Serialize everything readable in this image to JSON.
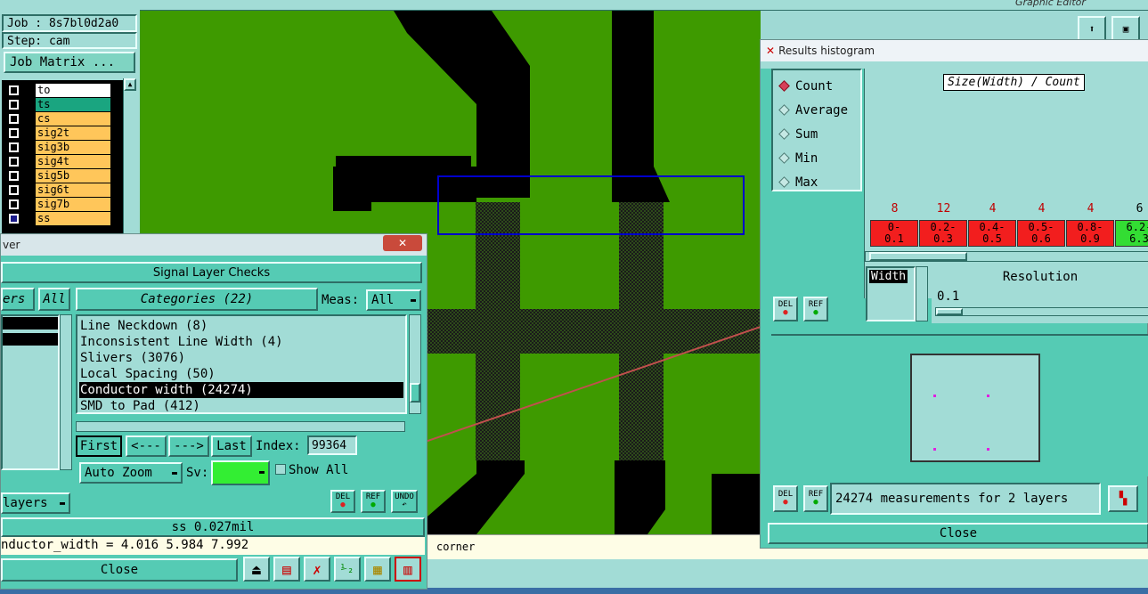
{
  "top_left": {
    "job": "Job : 8s7bl0d2a0",
    "step": "Step: cam",
    "job_matrix_button": "Job Matrix ..."
  },
  "layers": [
    {
      "name": "to",
      "color": "#ffffff"
    },
    {
      "name": "ts",
      "color": "#1aa580"
    },
    {
      "name": "cs",
      "color": "#ffc65a"
    },
    {
      "name": "sig2t",
      "color": "#ffc65a"
    },
    {
      "name": "sig3b",
      "color": "#ffc65a"
    },
    {
      "name": "sig4t",
      "color": "#ffc65a"
    },
    {
      "name": "sig5b",
      "color": "#ffc65a"
    },
    {
      "name": "sig6t",
      "color": "#ffc65a"
    },
    {
      "name": "sig7b",
      "color": "#ffc65a"
    },
    {
      "name": "ss",
      "color": "#ffc65a"
    }
  ],
  "graphic_editor_label": "Graphic Editor",
  "status_text": "corner",
  "checks_window": {
    "title_fragment": "ver",
    "close_x": "✕",
    "header": "Signal Layer Checks",
    "layers_fragment": "ers",
    "all_button": "All",
    "categories_label": "Categories (22)",
    "meas_label": "Meas:",
    "meas_value": "All",
    "categories": [
      "Line Neckdown (8)",
      "Inconsistent Line Width (4)",
      "Slivers (3076)",
      "Local Spacing (50)",
      "Conductor width (24274)",
      "SMD to Pad (412)"
    ],
    "selected_index": 4,
    "nav": {
      "first": "First",
      "prev": "<---",
      "next": "--->",
      "last": "Last"
    },
    "index_label": "Index:",
    "index_value": "99364",
    "auto_zoom": "Auto Zoom",
    "sv_label": "Sv:",
    "show_all": "Show All",
    "layers_dropdown": "layers",
    "del": "DEL",
    "ref": "REF",
    "undo": "UNDO",
    "measure_readout": "ss 0.027mil",
    "formula": "nductor_width = 4.016 5.984 7.992",
    "close": "Close"
  },
  "histogram_window": {
    "title": "Results histogram",
    "options": [
      "Count",
      "Average",
      "Sum",
      "Min",
      "Max"
    ],
    "selected_option": 0,
    "chart_title": "Size(Width) / Count",
    "bins": [
      {
        "count": "8",
        "label": [
          "0-",
          "0.1"
        ],
        "color": "#f21e1e"
      },
      {
        "count": "12",
        "label": [
          "0.2-",
          "0.3"
        ],
        "color": "#f21e1e"
      },
      {
        "count": "4",
        "label": [
          "0.4-",
          "0.5"
        ],
        "color": "#f21e1e"
      },
      {
        "count": "4",
        "label": [
          "0.5-",
          "0.6"
        ],
        "color": "#f21e1e"
      },
      {
        "count": "4",
        "label": [
          "0.8-",
          "0.9"
        ],
        "color": "#f21e1e"
      },
      {
        "count": "6",
        "label": [
          "6.2-",
          "6.3"
        ],
        "color": "#33dd33"
      }
    ],
    "width_label": "Width",
    "resolution_label": "Resolution",
    "resolution_value": "0.1",
    "del": "DEL",
    "ref": "REF",
    "summary": "24274 measurements for 2 layers",
    "close": "Close"
  }
}
